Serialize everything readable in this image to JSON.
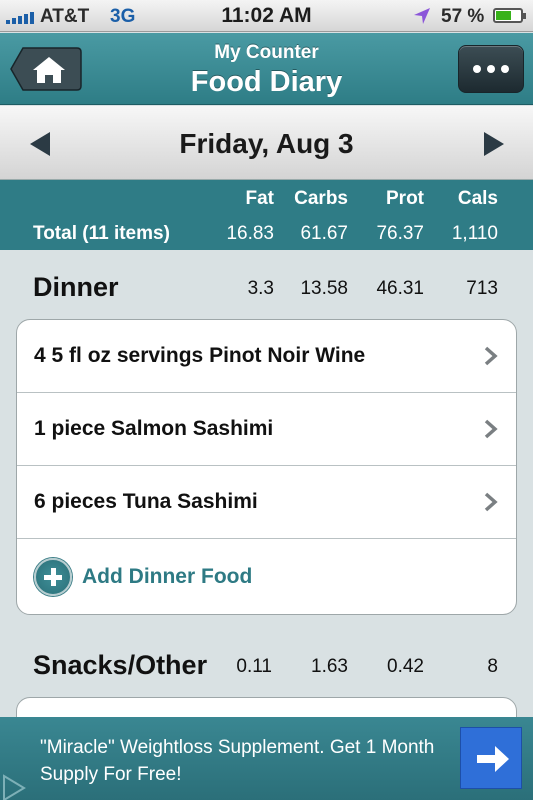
{
  "status_bar": {
    "carrier": "AT&T",
    "network": "3G",
    "time": "11:02 AM",
    "battery_text": "57 %",
    "battery_level": 0.57,
    "icons": [
      "signal-bars-icon",
      "location-arrow-icon",
      "battery-icon"
    ]
  },
  "nav": {
    "subtitle": "My Counter",
    "title": "Food Diary",
    "home_icon": "home-icon",
    "more_icon": "ellipsis-icon"
  },
  "date_bar": {
    "date": "Friday, Aug 3",
    "prev_icon": "left-arrow-icon",
    "next_icon": "right-arrow-icon"
  },
  "totals": {
    "headers": [
      "Fat",
      "Carbs",
      "Prot",
      "Cals"
    ],
    "label": "Total (11 items)",
    "values": [
      "16.83",
      "61.67",
      "76.37",
      "1,110"
    ]
  },
  "meals": [
    {
      "name": "Dinner",
      "values": [
        "3.3",
        "13.58",
        "46.31",
        "713"
      ],
      "items": [
        "4 5 fl oz servings Pinot Noir Wine",
        "1 piece Salmon Sashimi",
        "6 pieces Tuna Sashimi"
      ],
      "add_label": "Add Dinner Food"
    },
    {
      "name": "Snacks/Other",
      "values": [
        "0.11",
        "1.63",
        "0.42",
        "8"
      ]
    }
  ],
  "ad": {
    "text": "\"Miracle\" Weightloss Supplement. Get 1 Month Supply For Free!",
    "button_icon": "right-arrow-icon"
  },
  "colors": {
    "teal": "#2f7c86",
    "ad_button": "#2f6fd8",
    "link": "#2e7a84"
  }
}
